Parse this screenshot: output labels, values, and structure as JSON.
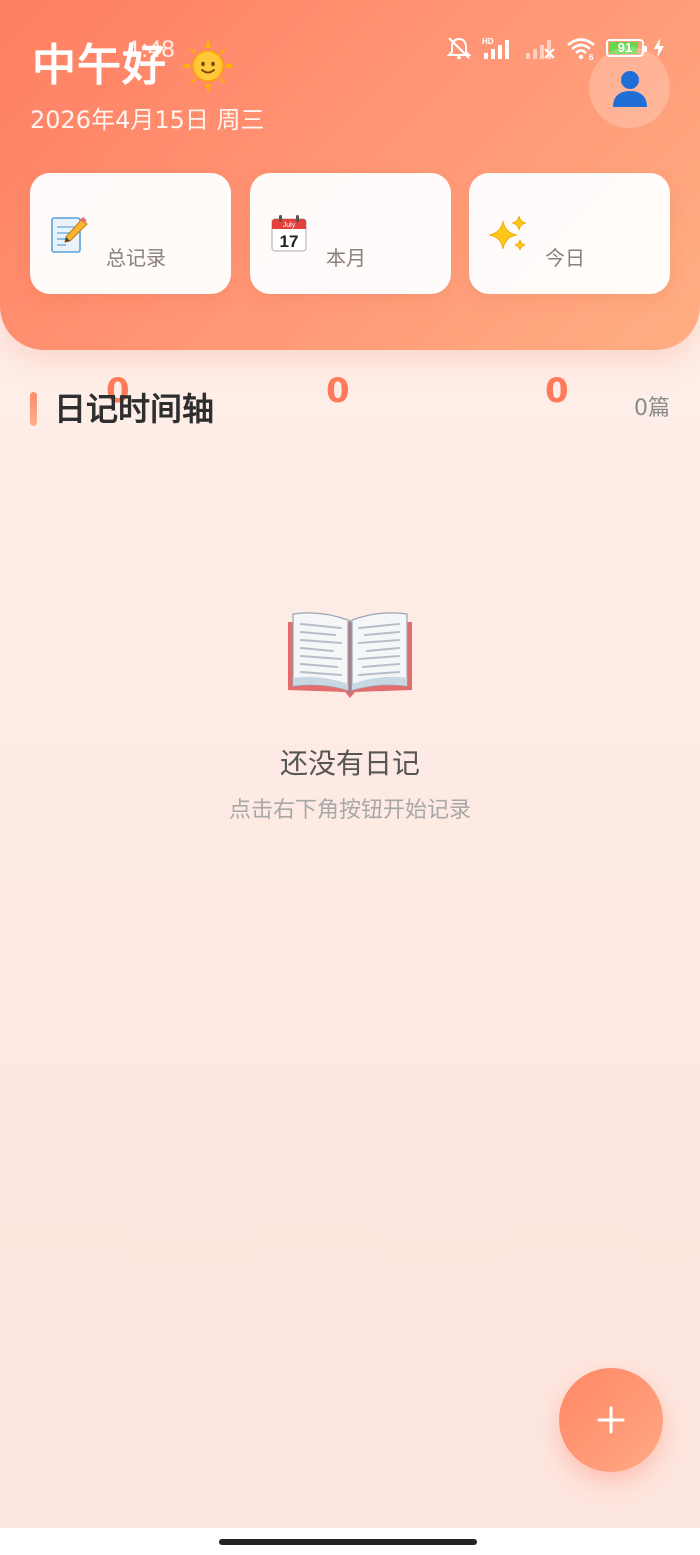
{
  "status_bar": {
    "time": "1:48",
    "battery_level": "91",
    "battery_fraction": 0.91,
    "icons": [
      "mute-icon",
      "hd-signal-icon",
      "no-signal-icon",
      "wifi-icon",
      "battery-icon",
      "charging-icon"
    ]
  },
  "header": {
    "greeting": "中午好",
    "greeting_icon": "sun-icon",
    "date": "2026年4月15日 周三",
    "avatar_icon": "user-icon"
  },
  "stats": [
    {
      "icon": "memo-icon",
      "value": "0",
      "label": "总记录"
    },
    {
      "icon": "calendar-icon",
      "value": "0",
      "label": "本月"
    },
    {
      "icon": "sparkles-icon",
      "value": "0",
      "label": "今日"
    }
  ],
  "timeline": {
    "title": "日记时间轴",
    "count": "0篇"
  },
  "empty_state": {
    "icon": "open-book-icon",
    "title": "还没有日记",
    "subtitle": "点击右下角按钮开始记录"
  },
  "fab": {
    "icon": "plus-icon"
  },
  "colors": {
    "header_gradient_start": "#ff7f62",
    "header_gradient_end": "#ffae84",
    "accent": "#ff7a59",
    "background": "#fdf1ec",
    "battery": "#67d64a"
  }
}
